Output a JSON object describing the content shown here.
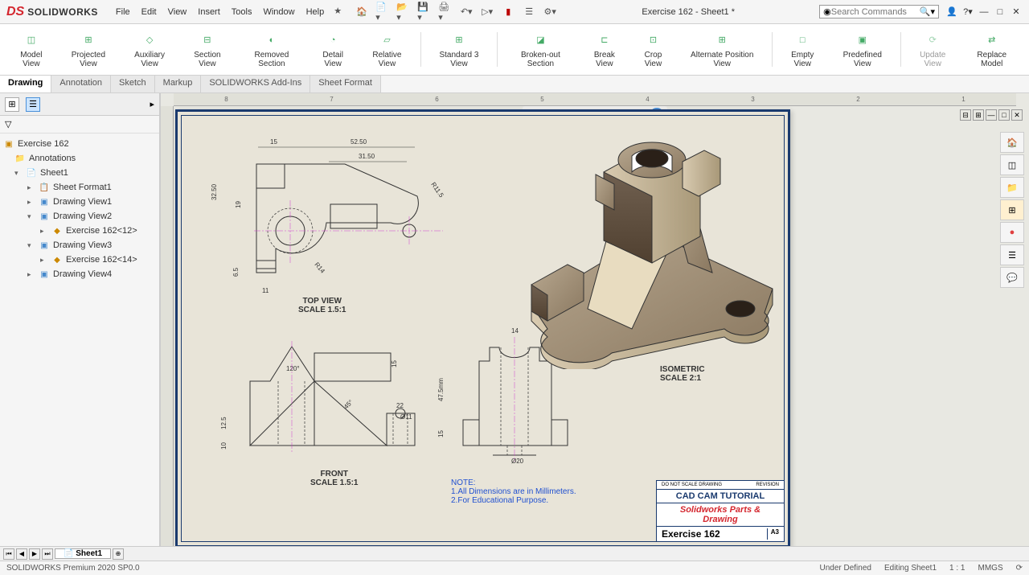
{
  "app": {
    "name": "SOLIDWORKS"
  },
  "menu": [
    "File",
    "Edit",
    "View",
    "Insert",
    "Tools",
    "Window",
    "Help"
  ],
  "doc_title": "Exercise 162 - Sheet1 *",
  "search_placeholder": "Search Commands",
  "ribbon": {
    "buttons": [
      {
        "label": "Model View"
      },
      {
        "label": "Projected View"
      },
      {
        "label": "Auxiliary View"
      },
      {
        "label": "Section View"
      },
      {
        "label": "Removed Section"
      },
      {
        "label": "Detail View"
      },
      {
        "label": "Relative View"
      },
      {
        "label": "Standard 3 View"
      },
      {
        "label": "Broken-out Section"
      },
      {
        "label": "Break View"
      },
      {
        "label": "Crop View"
      },
      {
        "label": "Alternate Position View"
      },
      {
        "label": "Empty View"
      },
      {
        "label": "Predefined View"
      },
      {
        "label": "Update View"
      },
      {
        "label": "Replace Model"
      }
    ]
  },
  "tabs": [
    "Drawing",
    "Annotation",
    "Sketch",
    "Markup",
    "SOLIDWORKS Add-Ins",
    "Sheet Format"
  ],
  "tree": {
    "root": "Exercise 162",
    "items": [
      {
        "label": "Annotations",
        "level": 1,
        "icon": "folder"
      },
      {
        "label": "Sheet1",
        "level": 1,
        "icon": "folder",
        "expand": "▾"
      },
      {
        "label": "Sheet Format1",
        "level": 2,
        "icon": "folder",
        "expand": "▸"
      },
      {
        "label": "Drawing View1",
        "level": 2,
        "icon": "view",
        "expand": "▸"
      },
      {
        "label": "Drawing View2",
        "level": 2,
        "icon": "view",
        "expand": "▾"
      },
      {
        "label": "Exercise 162<12>",
        "level": 3,
        "icon": "part",
        "expand": "▸"
      },
      {
        "label": "Drawing View3",
        "level": 2,
        "icon": "view",
        "expand": "▾"
      },
      {
        "label": "Exercise 162<14>",
        "level": 3,
        "icon": "part",
        "expand": "▸"
      },
      {
        "label": "Drawing View4",
        "level": 2,
        "icon": "view",
        "expand": "▸"
      }
    ]
  },
  "ruler_marks": [
    "8",
    "7",
    "6",
    "5",
    "4",
    "3",
    "2",
    "1"
  ],
  "views": {
    "top": {
      "title": "TOP VIEW",
      "scale": "SCALE 1.5:1"
    },
    "front": {
      "title": "FRONT",
      "scale": "SCALE 1.5:1"
    },
    "iso": {
      "title": "ISOMETRIC",
      "scale": "SCALE 2:1"
    }
  },
  "dimensions": {
    "top_15": "15",
    "top_52_5": "52.50",
    "top_31_5": "31.50",
    "top_32_5": "32.50",
    "top_19": "19",
    "top_11": "11",
    "top_6_5": "6.5",
    "top_r11_5": "R11.5",
    "top_r14": "R14",
    "front_120": "120°",
    "front_45": "45°",
    "front_12_5": "12.5",
    "front_10": "10",
    "front_15": "15",
    "front_22": "22",
    "front_d11": "Ø11",
    "right_14": "14",
    "right_47_5": "47.5mm",
    "right_15": "15",
    "right_d20": "Ø20"
  },
  "notes": {
    "header": "NOTE:",
    "line1": "1.All Dimensions are in Millimeters.",
    "line2": "2.For Educational Purpose."
  },
  "title_block": {
    "header": "CAD CAM TUTORIAL",
    "subtitle": "Solidworks Parts & Drawing",
    "exercise": "Exercise 162",
    "size": "A3"
  },
  "sheet_tab": "Sheet1",
  "status": {
    "left": "SOLIDWORKS Premium 2020 SP0.0",
    "state": "Under Defined",
    "editing": "Editing Sheet1",
    "scale": "1 : 1",
    "units": "MMGS"
  }
}
